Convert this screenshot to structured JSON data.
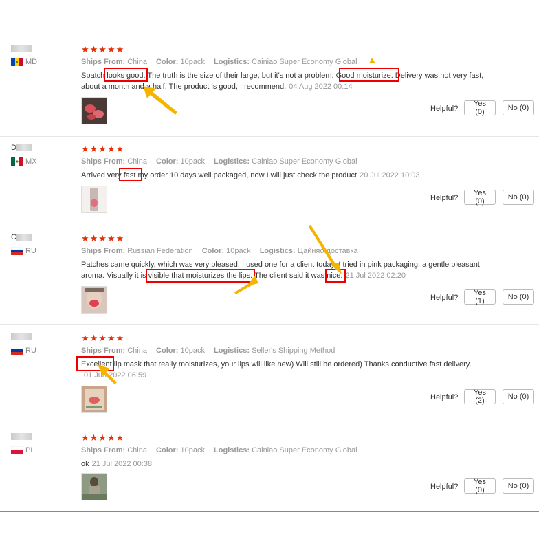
{
  "helpful_label": "Helpful?",
  "reviews": [
    {
      "name_initial": "",
      "country": "MD",
      "stars": "★★★★★",
      "ships_from_label": "Ships From:",
      "ships_from": "China",
      "color_label": "Color:",
      "color": "10pack",
      "logistics_label": "Logistics:",
      "logistics": "Cainiao Super Economy Global",
      "text": "Spatch looks good. The truth is the size of their large, but it's not a problem. Good moisturize. Delivery was not very fast, about a month and a half. The product is good, I recommend.",
      "date": "04 Aug 2022 00:14",
      "yes": "Yes (0)",
      "no": "No (0)"
    },
    {
      "name_initial": "D",
      "country": "MX",
      "stars": "★★★★★",
      "ships_from_label": "Ships From:",
      "ships_from": "China",
      "color_label": "Color:",
      "color": "10pack",
      "logistics_label": "Logistics:",
      "logistics": "Cainiao Super Economy Global",
      "text": "Arrived very fast my order 10 days well packaged, now I will just check the product",
      "date": "20 Jul 2022 10:03",
      "yes": "Yes (0)",
      "no": "No (0)"
    },
    {
      "name_initial": "C",
      "country": "RU",
      "stars": "★★★★★",
      "ships_from_label": "Ships From:",
      "ships_from": "Russian Federation",
      "color_label": "Color:",
      "color": "10pack",
      "logistics_label": "Logistics:",
      "logistics": "Цайняо доставка",
      "text": "Patches came quickly, which was very pleased. I used one for a client today. I tried in pink packaging, a gentle pleasant aroma. Visually it is visible that moisturizes the lips. The client said it was nice.",
      "date": "21 Jul 2022 02:20",
      "yes": "Yes (1)",
      "no": "No (0)"
    },
    {
      "name_initial": "",
      "country": "RU",
      "stars": "★★★★★",
      "ships_from_label": "Ships From:",
      "ships_from": "China",
      "color_label": "Color:",
      "color": "10pack",
      "logistics_label": "Logistics:",
      "logistics": "Seller's Shipping Method",
      "text": "Excellent lip mask that really moisturizes, your lips will like new) Will still be ordered) Thanks conductive fast delivery.",
      "date": "01 Jun 2022 06:59",
      "yes": "Yes (2)",
      "no": "No (0)"
    },
    {
      "name_initial": "",
      "country": "PL",
      "stars": "★★★★★",
      "ships_from_label": "Ships From:",
      "ships_from": "China",
      "color_label": "Color:",
      "color": "10pack",
      "logistics_label": "Logistics:",
      "logistics": "Cainiao Super Economy Global",
      "text": "ok",
      "date": "21 Jul 2022 00:38",
      "yes": "Yes (0)",
      "no": "No (0)"
    }
  ],
  "colors": {
    "star": "#e62e04",
    "highlight": "#e00000",
    "arrow": "#f5b400",
    "muted": "#999999"
  }
}
